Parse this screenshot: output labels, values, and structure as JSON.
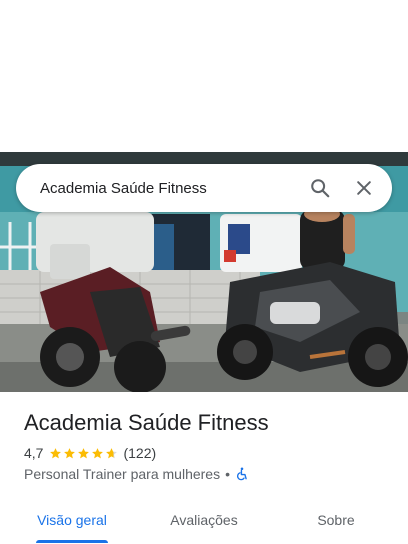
{
  "search": {
    "query": "Academia Saúde Fitness",
    "search_icon": "search-icon",
    "close_icon": "close-icon"
  },
  "hero": {
    "image": "storefront-photo-motorcycles"
  },
  "place": {
    "title": "Academia Saúde Fitness",
    "rating": "4,7",
    "rating_value": 4.7,
    "star_count": 5,
    "reviews": "(122)",
    "category": "Personal Trainer para mulheres",
    "separator": "•",
    "accessibility_icon": "wheelchair-icon"
  },
  "tabs": [
    {
      "label": "Visão geral",
      "active": true
    },
    {
      "label": "Avaliações",
      "active": false
    },
    {
      "label": "Sobre",
      "active": false
    }
  ],
  "colors": {
    "accent": "#1a73e8",
    "star": "#fbbc04",
    "star_empty": "#dadce0",
    "text_primary": "#202124",
    "text_secondary": "#5f6368"
  }
}
